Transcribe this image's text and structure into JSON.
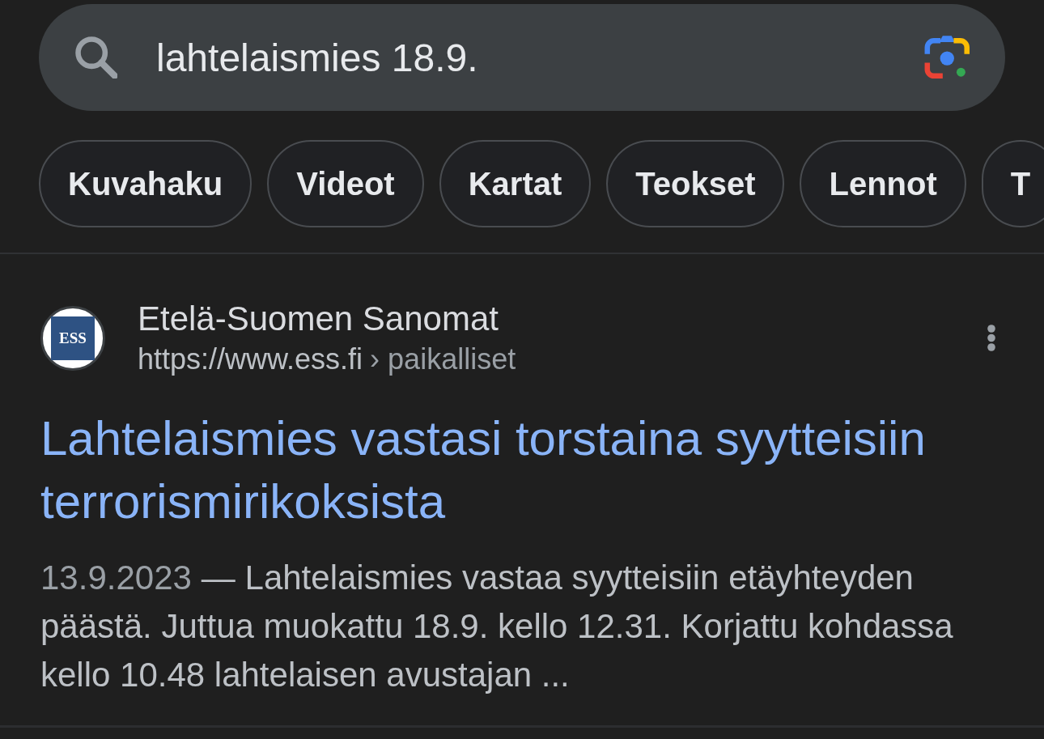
{
  "search": {
    "query": "lahtelaismies 18.9."
  },
  "filter_chips": [
    "Kuvahaku",
    "Videot",
    "Kartat",
    "Teokset",
    "Lennot",
    "T"
  ],
  "results": [
    {
      "site_logo": "ESS",
      "site_name": "Etelä-Suomen Sanomat",
      "url": "https://www.ess.fi",
      "breadcrumb": "› paikalliset",
      "title": "Lahtelaismies vastasi torstaina syytteisiin terrorismirikoksista",
      "date": "13.9.2023",
      "snippet": "— Lahtelaismies vastaa syytteisiin etäyhteyden päästä. Juttua muokattu 18.9. kello 12.31. Korjattu kohdassa kello 10.48 lahtelaisen avustajan ..."
    }
  ]
}
